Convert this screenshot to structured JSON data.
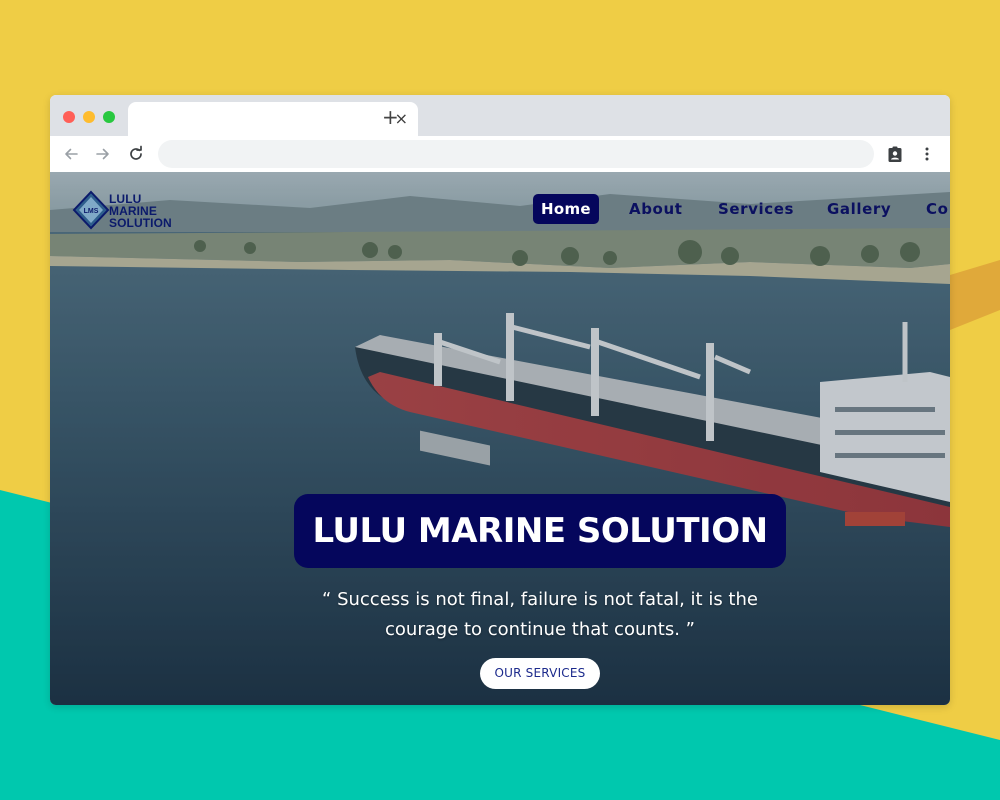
{
  "browser": {
    "tab_close_glyph": "×",
    "new_tab_glyph": "+",
    "address_value": "",
    "icons": [
      "back-arrow-icon",
      "forward-arrow-icon",
      "reload-icon",
      "clipboard-profile-icon",
      "kebab-menu-icon"
    ]
  },
  "site": {
    "logo": {
      "badge": "LMS",
      "line1": "LULU",
      "line2": "MARINE",
      "line3": "SOLUTION"
    },
    "nav": {
      "items": [
        "Home",
        "About",
        "Services",
        "Gallery",
        "Co"
      ],
      "active": "Home"
    },
    "hero": {
      "title": "LULU MARINE SOLUTION",
      "quote": "“ Success is not final, failure is not fatal, it is the courage to continue that counts. ”",
      "cta_label": "OUR SERVICES"
    }
  },
  "colors": {
    "background_yellow": "#EFCD45",
    "background_teal": "#00C8AE",
    "brand_navy": "#05065C",
    "nav_text": "#0B1060",
    "cta_text": "#1C2A8C"
  }
}
